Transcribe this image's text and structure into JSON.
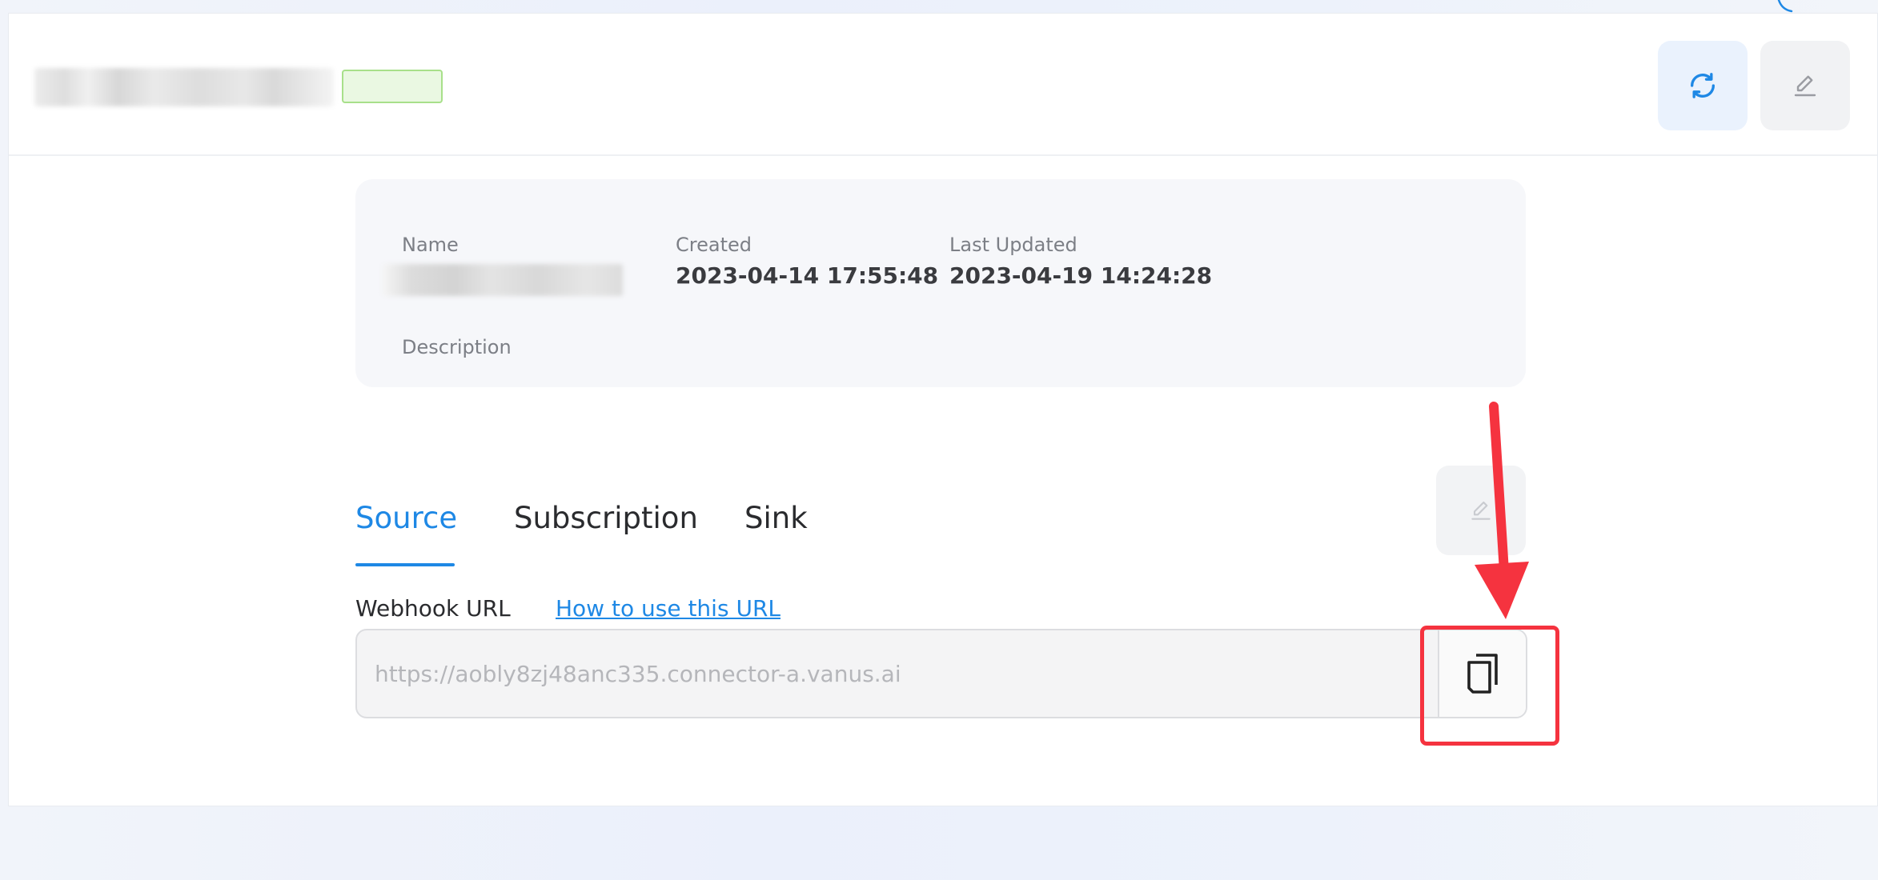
{
  "header": {
    "status_badge": "",
    "refresh_icon": "refresh-icon",
    "edit_icon": "pencil-icon"
  },
  "info": {
    "name_label": "Name",
    "created_label": "Created",
    "created_value": "2023-04-14 17:55:48",
    "updated_label": "Last Updated",
    "updated_value": "2023-04-19 14:24:28",
    "description_label": "Description"
  },
  "tabs": [
    {
      "label": "Source",
      "active": true
    },
    {
      "label": "Subscription",
      "active": false
    },
    {
      "label": "Sink",
      "active": false
    }
  ],
  "source": {
    "webhook_label": "Webhook URL",
    "howto_link": "How to use this URL",
    "url_placeholder": "https://aobly8zj48anc335.connector-a.vanus.ai",
    "copy_icon": "copy-icon"
  },
  "colors": {
    "accent": "#1e88e5",
    "annotation": "#f5333f",
    "status_border": "#a8e08a"
  }
}
